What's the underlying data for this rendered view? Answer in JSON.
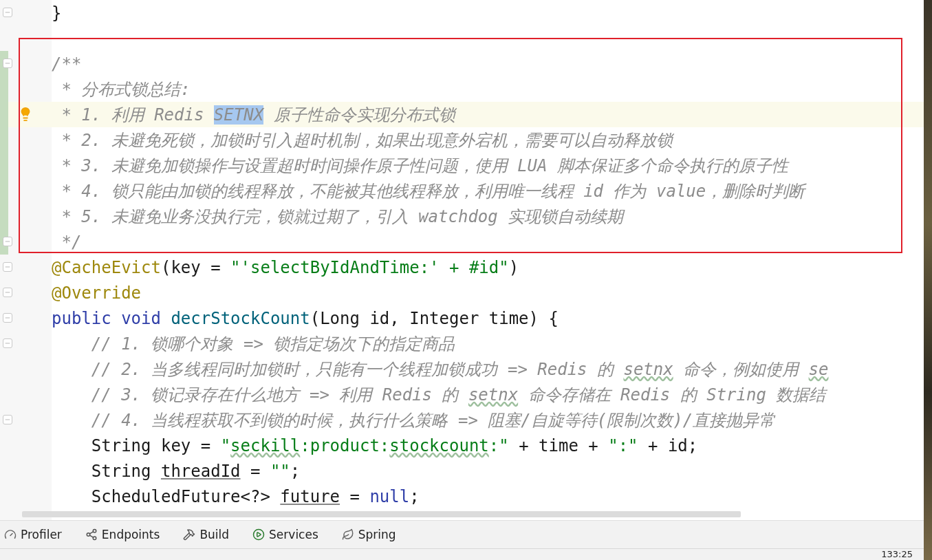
{
  "editor": {
    "lines": [
      {
        "changed": false,
        "fold": true,
        "bulb": false,
        "current": false,
        "tokens": [
          {
            "kind": "plain",
            "text": "}"
          }
        ]
      },
      {
        "changed": false,
        "fold": false,
        "bulb": false,
        "current": false
      },
      {
        "changed": true,
        "fold": true,
        "bulb": false,
        "current": false,
        "tokens": [
          {
            "kind": "comment",
            "text": "/**"
          }
        ]
      },
      {
        "changed": true,
        "fold": false,
        "bulb": false,
        "current": false,
        "tokens": [
          {
            "kind": "comment",
            "text": " * 分布式锁总结:"
          }
        ]
      },
      {
        "changed": true,
        "fold": false,
        "bulb": true,
        "current": true,
        "tokens": [
          {
            "kind": "comment",
            "text": " * 1. 利用 Redis "
          },
          {
            "kind": "comment-selected",
            "text": "SETNX"
          },
          {
            "kind": "comment",
            "text": " 原子性命令实现分布式锁"
          }
        ]
      },
      {
        "changed": true,
        "fold": false,
        "bulb": false,
        "current": false,
        "tokens": [
          {
            "kind": "comment",
            "text": " * 2. 未避免死锁，加锁时引入超时机制，如果出现意外宕机，需要可以自动释放锁"
          }
        ]
      },
      {
        "changed": true,
        "fold": false,
        "bulb": false,
        "current": false,
        "tokens": [
          {
            "kind": "comment",
            "text": " * 3. 未避免加锁操作与设置超时时间操作原子性问题，使用 LUA 脚本保证多个命令执行的原子性"
          }
        ]
      },
      {
        "changed": true,
        "fold": false,
        "bulb": false,
        "current": false,
        "tokens": [
          {
            "kind": "comment",
            "text": " * 4. 锁只能由加锁的线程释放，不能被其他线程释放，利用唯一线程 id 作为 value，删除时判断"
          }
        ]
      },
      {
        "changed": true,
        "fold": false,
        "bulb": false,
        "current": false,
        "tokens": [
          {
            "kind": "comment",
            "text": " * 5. 未避免业务没执行完，锁就过期了，引入 watchdog 实现锁自动续期"
          }
        ]
      },
      {
        "changed": true,
        "fold": true,
        "bulb": false,
        "current": false,
        "tokens": [
          {
            "kind": "comment",
            "text": " */"
          }
        ]
      },
      {
        "changed": false,
        "fold": true,
        "bulb": false,
        "current": false,
        "tokens": [
          {
            "kind": "annotation",
            "text": "@CacheEvict"
          },
          {
            "kind": "plain",
            "text": "(key = "
          },
          {
            "kind": "string",
            "text": "\"'selectByIdAndTime:' + #id\""
          },
          {
            "kind": "plain",
            "text": ")"
          }
        ]
      },
      {
        "changed": false,
        "fold": true,
        "bulb": false,
        "current": false,
        "tokens": [
          {
            "kind": "annotation",
            "text": "@Override"
          }
        ]
      },
      {
        "changed": false,
        "fold": true,
        "bulb": false,
        "current": false,
        "tokens": [
          {
            "kind": "keyword",
            "text": "public void "
          },
          {
            "kind": "method",
            "text": "decrStockCount"
          },
          {
            "kind": "plain",
            "text": "(Long id, Integer time) {"
          }
        ]
      },
      {
        "changed": false,
        "fold": true,
        "bulb": false,
        "current": false,
        "tokens": [
          {
            "kind": "comment",
            "text": "    // 1. 锁哪个对象 => 锁指定场次下的指定商品"
          }
        ]
      },
      {
        "changed": false,
        "fold": false,
        "bulb": false,
        "current": false,
        "tokens": [
          {
            "kind": "comment",
            "text": "    // 2. 当多线程同时加锁时，只能有一个线程加锁成功 => Redis 的 "
          },
          {
            "kind": "comment-typo",
            "text": "setnx"
          },
          {
            "kind": "comment",
            "text": " 命令，例如使用 "
          },
          {
            "kind": "comment-typo",
            "text": "se"
          }
        ]
      },
      {
        "changed": false,
        "fold": false,
        "bulb": false,
        "current": false,
        "tokens": [
          {
            "kind": "comment",
            "text": "    // 3. 锁记录存在什么地方 => 利用 Redis 的 "
          },
          {
            "kind": "comment-typo",
            "text": "setnx"
          },
          {
            "kind": "comment",
            "text": " 命令存储在 Redis 的 String 数据结"
          }
        ]
      },
      {
        "changed": false,
        "fold": true,
        "bulb": false,
        "current": false,
        "tokens": [
          {
            "kind": "comment",
            "text": "    // 4. 当线程获取不到锁的时候，执行什么策略 => 阻塞/自旋等待(限制次数)/直接抛异常"
          }
        ]
      },
      {
        "changed": false,
        "fold": false,
        "bulb": false,
        "current": false,
        "tokens": [
          {
            "kind": "plain",
            "text": "    String key = "
          },
          {
            "kind": "string",
            "text": "\""
          },
          {
            "kind": "string-typo",
            "text": "seckill"
          },
          {
            "kind": "string",
            "text": ":product:"
          },
          {
            "kind": "string-typo",
            "text": "stockcount"
          },
          {
            "kind": "string",
            "text": ":\""
          },
          {
            "kind": "plain",
            "text": " + time + "
          },
          {
            "kind": "string",
            "text": "\":\""
          },
          {
            "kind": "plain",
            "text": " + id;"
          }
        ]
      },
      {
        "changed": false,
        "fold": false,
        "bulb": false,
        "current": false,
        "tokens": [
          {
            "kind": "plain",
            "text": "    String "
          },
          {
            "kind": "field",
            "text": "threadId"
          },
          {
            "kind": "plain",
            "text": " = "
          },
          {
            "kind": "string",
            "text": "\"\""
          },
          {
            "kind": "plain",
            "text": ";"
          }
        ]
      },
      {
        "changed": false,
        "fold": false,
        "bulb": false,
        "current": false,
        "tokens": [
          {
            "kind": "plain",
            "text": "    ScheduledFuture<?> "
          },
          {
            "kind": "field",
            "text": "future"
          },
          {
            "kind": "plain",
            "text": " = "
          },
          {
            "kind": "keyword",
            "text": "null"
          },
          {
            "kind": "plain",
            "text": ";"
          }
        ]
      }
    ]
  },
  "tool_windows": [
    {
      "kind": "profiler",
      "label": "Profiler"
    },
    {
      "kind": "endpoints",
      "label": "Endpoints"
    },
    {
      "kind": "build",
      "label": "Build"
    },
    {
      "kind": "services",
      "label": "Services"
    },
    {
      "kind": "spring",
      "label": "Spring"
    }
  ],
  "status_bar": {
    "position": "133:25"
  }
}
